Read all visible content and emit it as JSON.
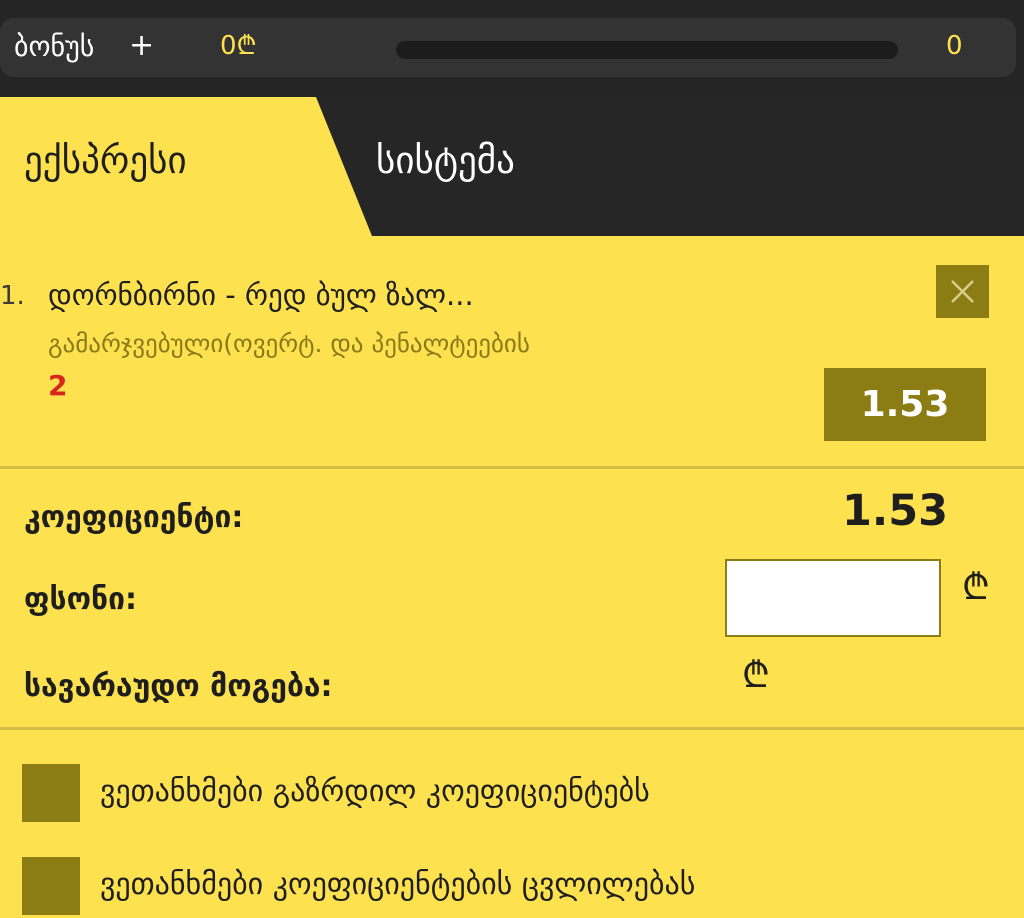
{
  "bonus_bar": {
    "label": "ბონუს",
    "add_symbol": "+",
    "amount": "0₾",
    "progress": 0,
    "count": "0"
  },
  "tabs": [
    {
      "label": "ექსპრესი",
      "active": true
    },
    {
      "label": "სისტემა",
      "active": false
    }
  ],
  "bet": {
    "index": "1.",
    "event": "დორნბირნი - რედ ბულ ზალ...",
    "market": "გამარჯვებული(ოვერტ. და პენალტეების",
    "outcome": "2",
    "odd": "1.53"
  },
  "summary": {
    "coefficient_label": "კოეფიციენტი:",
    "coefficient_value": "1.53",
    "stake_label": "ფსონი:",
    "stake_value": "",
    "currency_symbol": "₾",
    "possible_win_label": "სავარაუდო მოგება:"
  },
  "options": [
    {
      "label": "ვეთანხმები გაზრდილ კოეფიციენტებს",
      "checked": false
    },
    {
      "label": "ვეთანხმები კოეფიციენტების ცვლილებას",
      "checked": false
    }
  ],
  "colors": {
    "accent": "#fde14f",
    "dark": "#252525",
    "olive": "#8b7c14",
    "outcome": "#d9261c"
  }
}
